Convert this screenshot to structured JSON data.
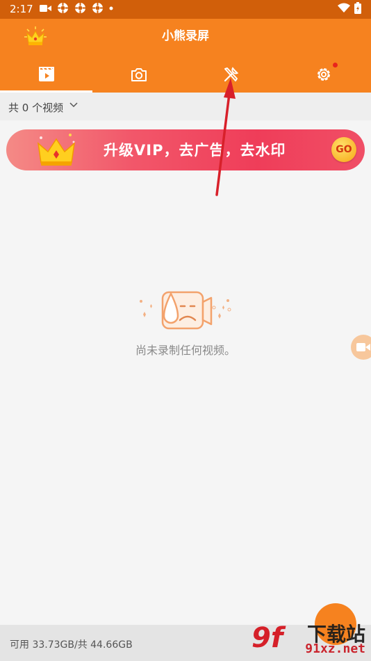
{
  "status_bar": {
    "time": "2:17",
    "icons": [
      "video-camera-icon",
      "app-notification-icon",
      "app-notification-icon",
      "app-notification-icon",
      "dot-icon",
      "wifi-icon",
      "battery-icon"
    ]
  },
  "app_bar": {
    "title": "小熊录屏",
    "tabs": [
      {
        "icon": "video-list-icon",
        "active": true
      },
      {
        "icon": "camera-icon",
        "active": false
      },
      {
        "icon": "tools-icon",
        "active": false
      },
      {
        "icon": "settings-icon",
        "active": false,
        "badge": true
      }
    ]
  },
  "filter": {
    "label": "共 0 个视频",
    "dropdown_icon": "chevron-down-icon"
  },
  "banner": {
    "text": "升级VIP，去广告，去水印",
    "go_label": "GO"
  },
  "empty_state": {
    "message": "尚未录制任何视频。"
  },
  "storage": {
    "text": "可用 33.73GB/共 44.66GB"
  },
  "watermark": {
    "logo": "9f",
    "top": "下载站",
    "bottom": "91xz.net"
  },
  "colors": {
    "status_bar": "#d15f0a",
    "primary": "#f6821f",
    "banner_red": "#ef3d59",
    "annotation_arrow": "#d8202a"
  }
}
